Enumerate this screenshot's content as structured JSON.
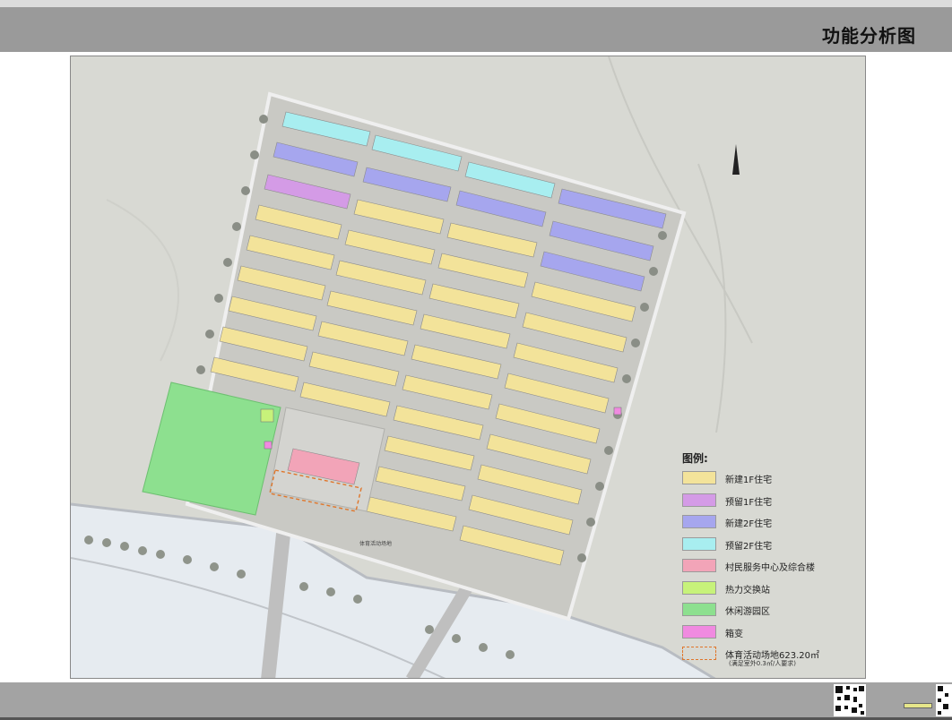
{
  "header": {
    "title": "功能分析图"
  },
  "plan": {
    "sports_field_label": "体育活动场地"
  },
  "legend": {
    "title": "图例:",
    "items": [
      {
        "label": "新建1F住宅",
        "color": "#f3e39a",
        "style": "fill"
      },
      {
        "label": "预留1F住宅",
        "color": "#d49be6",
        "style": "fill"
      },
      {
        "label": "新建2F住宅",
        "color": "#a6a6ee",
        "style": "fill"
      },
      {
        "label": "预留2F住宅",
        "color": "#a8eef0",
        "style": "fill"
      },
      {
        "label": "村民服务中心及综合楼",
        "color": "#f2a4b8",
        "style": "fill"
      },
      {
        "label": "热力交换站",
        "color": "#c7f27a",
        "style": "fill"
      },
      {
        "label": "休闲游园区",
        "color": "#8de08f",
        "style": "fill"
      },
      {
        "label": "箱变",
        "color": "#f08ae0",
        "style": "fill"
      },
      {
        "label": "体育活动场地623.20㎡",
        "note": "(满足室外0.3㎡/人要求)",
        "color": "#e0762a",
        "style": "dashed"
      }
    ]
  }
}
